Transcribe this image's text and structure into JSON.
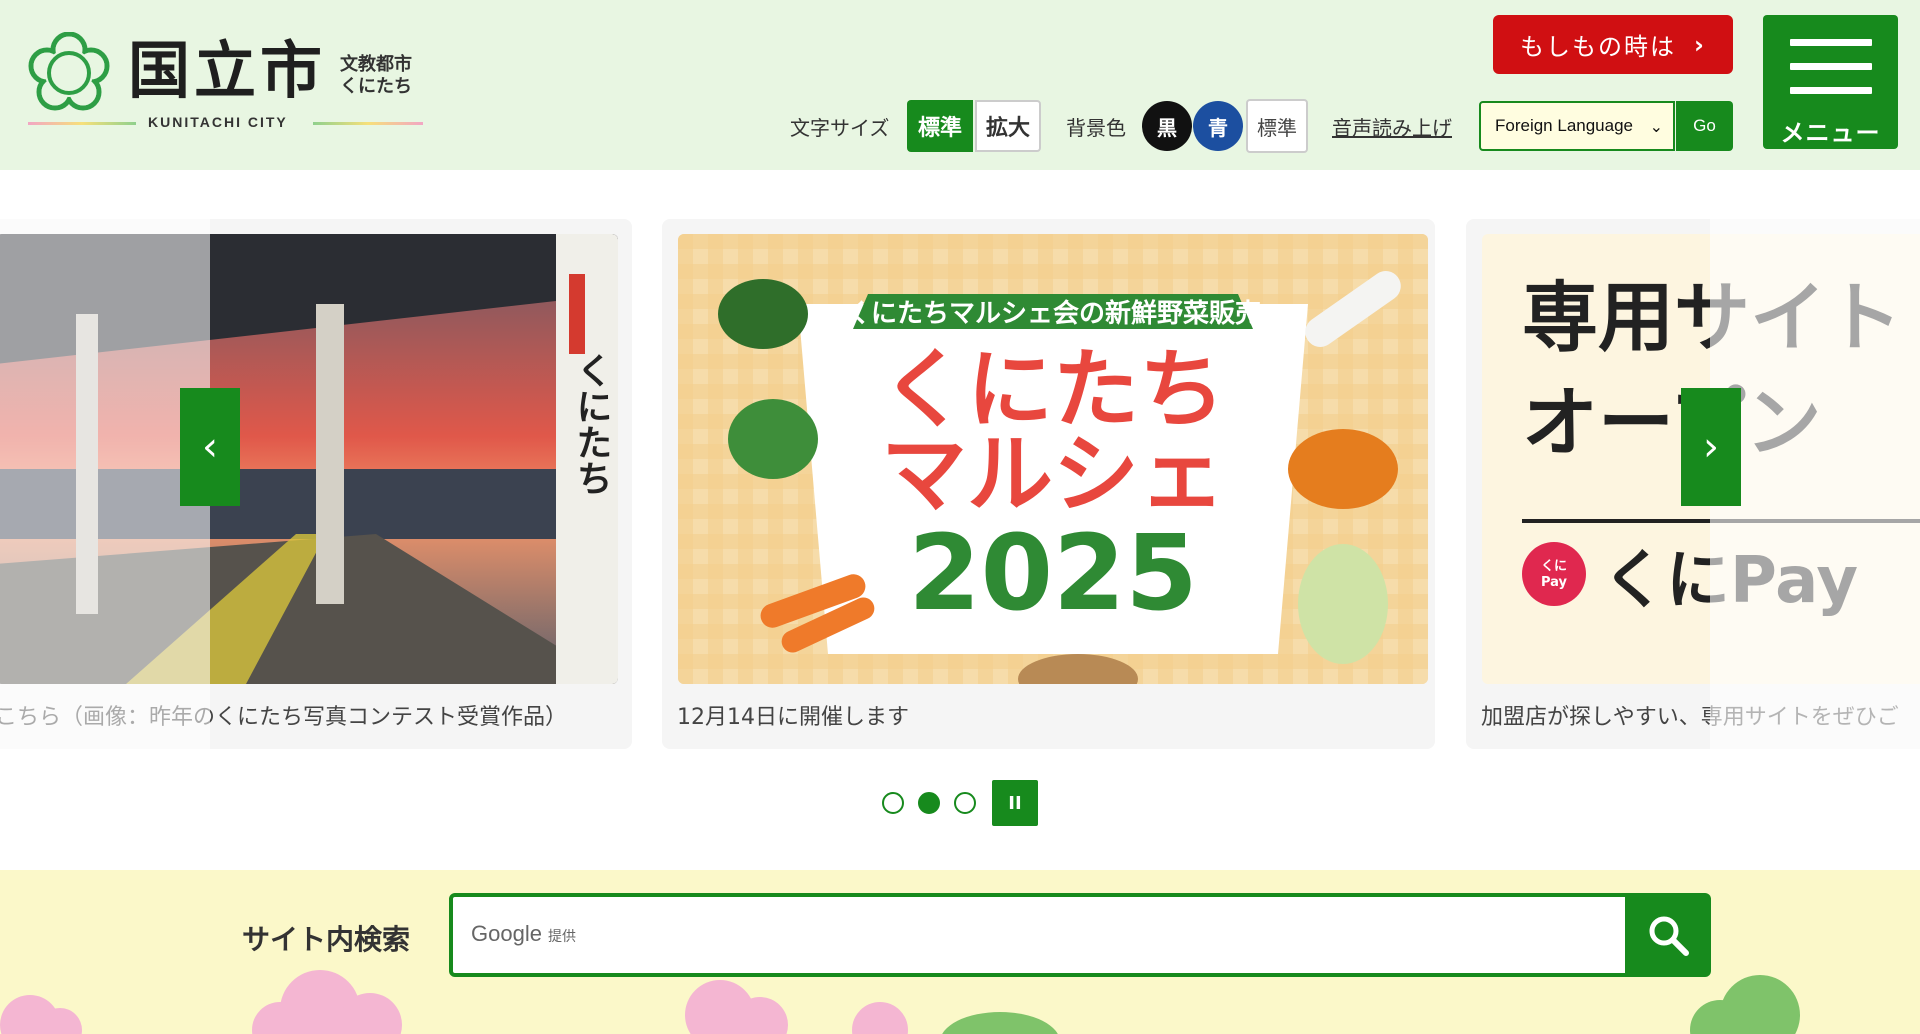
{
  "header": {
    "logo_kanji": "国立市",
    "logo_sub_1": "文教都市",
    "logo_sub_2": "くにたち",
    "logo_en": "KUNITACHI CITY",
    "emergency_label": "もしもの時は",
    "menu_label": "メニュー",
    "text_size": {
      "label": "文字サイズ",
      "standard": "標準",
      "large": "拡大"
    },
    "background_color": {
      "label": "背景色",
      "black": "黒",
      "blue": "青",
      "standard": "標準"
    },
    "voice_label": "音声読み上げ",
    "language_select": "Foreign Language",
    "go_label": "Go"
  },
  "carousel": {
    "slides": [
      {
        "caption": "こちら（画像：昨年のくにたち写真コンテスト受賞作品）",
        "sign_text": "くにたち"
      },
      {
        "caption": "12月14日に開催します",
        "banner_text": "くにたちマルシェ会の新鮮野菜販売",
        "title_1": "くにたち",
        "title_2": "マルシェ",
        "year": "2025"
      },
      {
        "caption": "加盟店が探しやすい、専用サイトをぜひご",
        "line_1": "専用サイト",
        "line_2": "オープン",
        "pay_text": "くにPay",
        "pay_badge_1": "くに",
        "pay_badge_2": "Pay"
      }
    ],
    "active_index": 2,
    "pause_label": "II",
    "prev_icon": "chevron-left-icon",
    "next_icon": "chevron-right-icon"
  },
  "search": {
    "label": "サイト内検索",
    "google_label": "Google",
    "provided_label": "提供",
    "button_icon": "search-icon"
  },
  "colors": {
    "brand_green": "#178a1d",
    "header_bg": "#e8f6e2",
    "emergency_red": "#d00f12",
    "search_band_bg": "#fbf8c9"
  }
}
